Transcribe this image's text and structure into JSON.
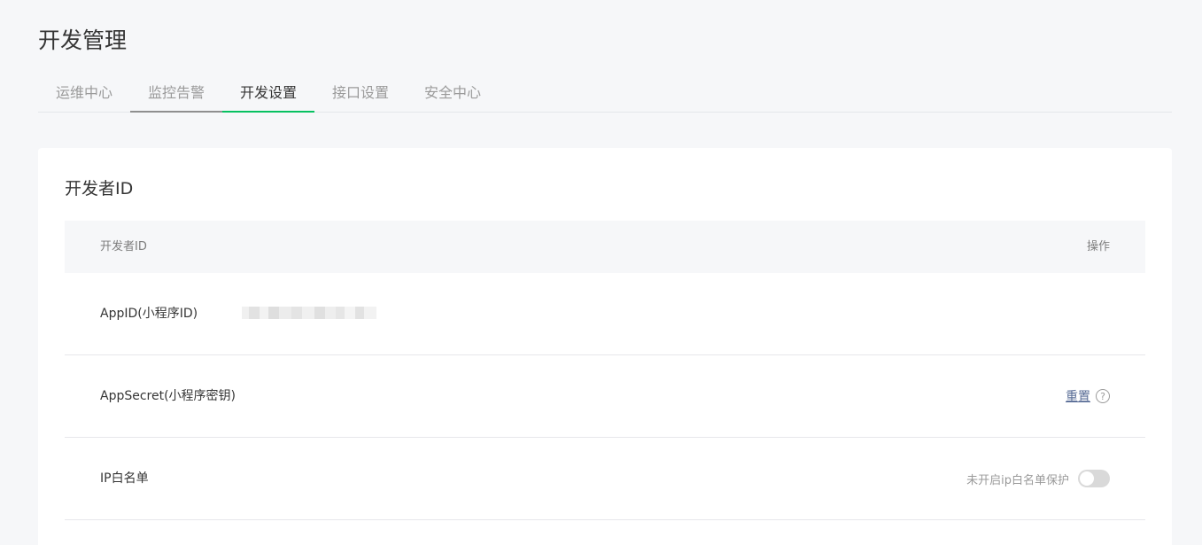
{
  "page": {
    "title": "开发管理"
  },
  "tabs": [
    {
      "label": "运维中心"
    },
    {
      "label": "监控告警"
    },
    {
      "label": "开发设置"
    },
    {
      "label": "接口设置"
    },
    {
      "label": "安全中心"
    }
  ],
  "developer_id": {
    "section_title": "开发者ID",
    "columns": {
      "name": "开发者ID",
      "action": "操作"
    },
    "rows": [
      {
        "label": "AppID(小程序ID)",
        "value_masked": true
      },
      {
        "label": "AppSecret(小程序密钥)",
        "action_label": "重置",
        "action_icon": "question-circle-icon"
      },
      {
        "label": "IP白名单",
        "status_text": "未开启ip白名单保护",
        "toggle_on": false
      }
    ]
  },
  "colors": {
    "accent": "#07c160",
    "link": "#576b95",
    "background": "#f6f7f9"
  }
}
